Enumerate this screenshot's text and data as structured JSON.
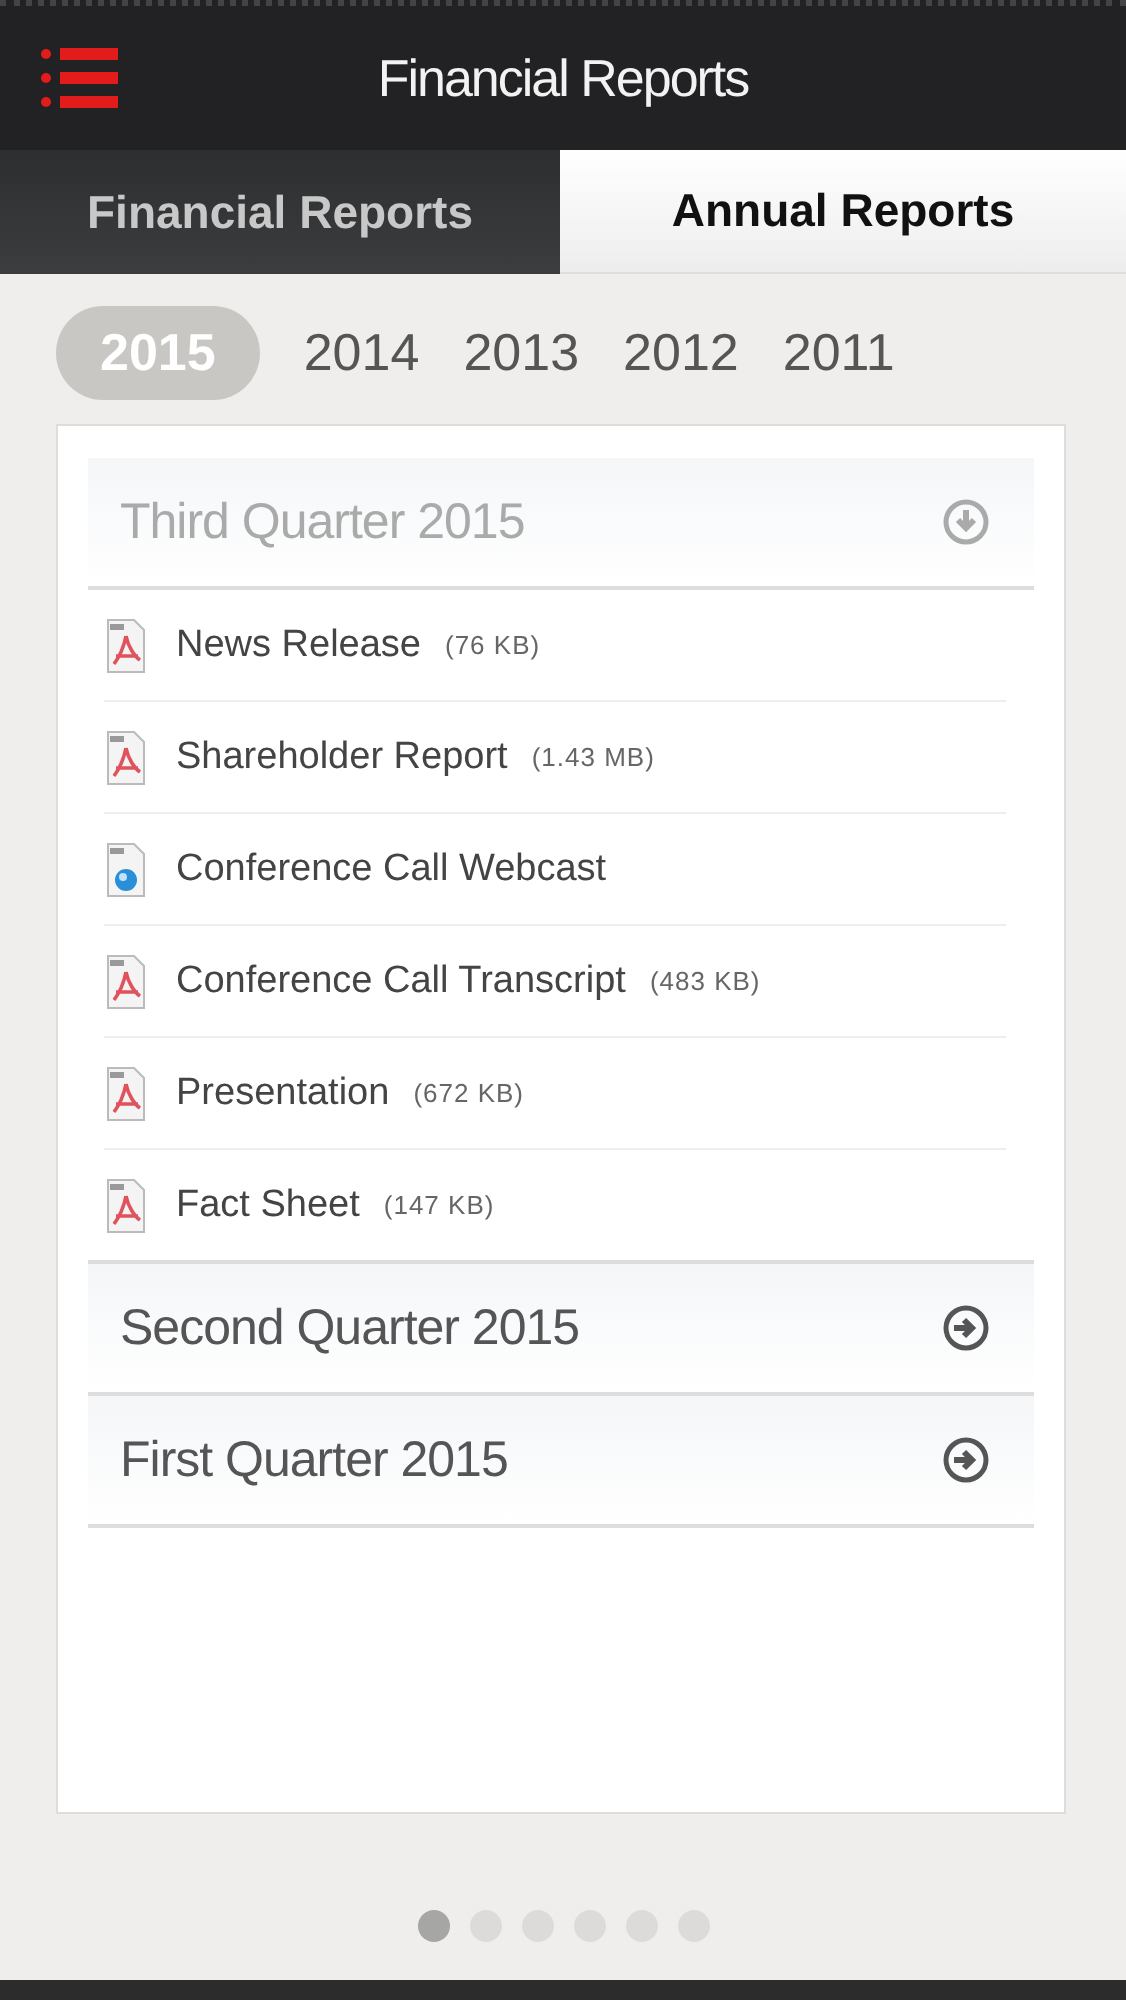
{
  "header": {
    "title": "Financial Reports"
  },
  "tabs": [
    {
      "label": "Financial Reports",
      "selected": false
    },
    {
      "label": "Annual Reports",
      "selected": true
    }
  ],
  "years": [
    {
      "label": "2015",
      "selected": true
    },
    {
      "label": "2014",
      "selected": false
    },
    {
      "label": "2013",
      "selected": false
    },
    {
      "label": "2012",
      "selected": false
    },
    {
      "label": "2011",
      "selected": false
    }
  ],
  "sections": [
    {
      "title": "Third Quarter 2015",
      "expanded": true,
      "files": [
        {
          "kind": "pdf",
          "name": "News Release",
          "size": "(76 KB)"
        },
        {
          "kind": "pdf",
          "name": "Shareholder Report",
          "size": "(1.43 MB)"
        },
        {
          "kind": "webcast",
          "name": "Conference Call Webcast"
        },
        {
          "kind": "pdf",
          "name": "Conference Call Transcript",
          "size": "(483 KB)"
        },
        {
          "kind": "pdf",
          "name": "Presentation",
          "size": "(672 KB)"
        },
        {
          "kind": "pdf",
          "name": "Fact Sheet",
          "size": "(147 KB)"
        }
      ]
    },
    {
      "title": "Second Quarter 2015",
      "expanded": false
    },
    {
      "title": "First Quarter 2015",
      "expanded": false
    }
  ],
  "pages": [
    {
      "selected": true
    },
    {
      "selected": false
    },
    {
      "selected": false
    },
    {
      "selected": false
    },
    {
      "selected": false
    },
    {
      "selected": false
    }
  ]
}
